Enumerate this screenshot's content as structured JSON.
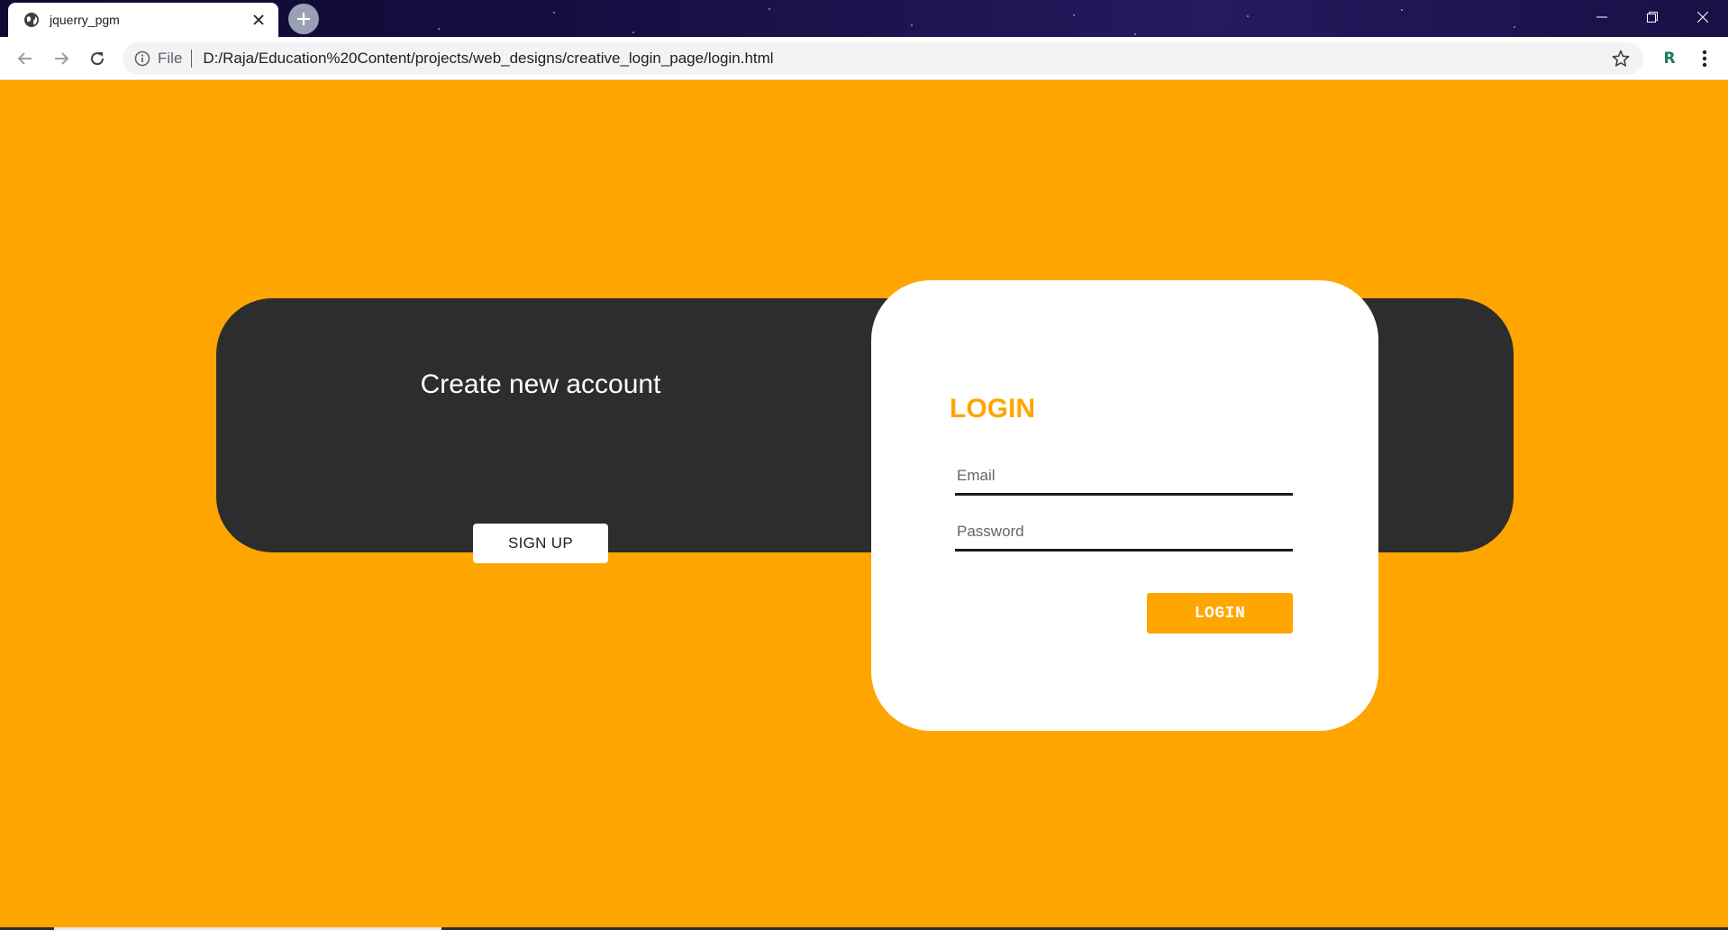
{
  "browser": {
    "tab_title": "jquerry_pgm",
    "url_scheme": "File",
    "url": "D:/Raja/Education%20Content/projects/web_designs/creative_login_page/login.html",
    "extension_label": "R",
    "icons": [
      "globe-icon",
      "close-icon",
      "plus-icon",
      "minimize-icon",
      "restore-icon",
      "window-close-icon",
      "back-arrow-icon",
      "forward-arrow-icon",
      "reload-icon",
      "info-icon",
      "star-icon",
      "kebab-menu-icon"
    ]
  },
  "signup_panel": {
    "title": "Create new account",
    "button_label": "SIGN UP"
  },
  "login_card": {
    "heading": "LOGIN",
    "email_placeholder": "Email",
    "password_placeholder": "Password",
    "button_label": "LOGIN"
  },
  "colors": {
    "background": "#ffa500",
    "dark_panel": "#2d2d2d",
    "card": "#ffffff",
    "accent": "#ffa500"
  }
}
